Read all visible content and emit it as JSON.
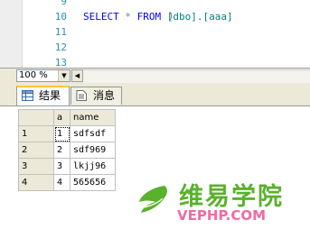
{
  "editor": {
    "lines": [
      {
        "num": "9",
        "code_paren": ")"
      },
      {
        "num": "10",
        "kw_select": "SELECT",
        "star": "*",
        "kw_from": "FROM",
        "table": "[dbo].[aaa]"
      },
      {
        "num": "11"
      },
      {
        "num": "12"
      },
      {
        "num": "13"
      }
    ]
  },
  "zoom": {
    "value": "100 %"
  },
  "tabs": [
    {
      "label": "结果",
      "icon": "grid-icon",
      "active": true
    },
    {
      "label": "消息",
      "icon": "message-icon",
      "active": false
    }
  ],
  "results": {
    "columns": [
      "a",
      "name"
    ],
    "rows": [
      {
        "row_num": "1",
        "a": "1",
        "name": "sdfsdf"
      },
      {
        "row_num": "2",
        "a": "2",
        "name": "sdf969"
      },
      {
        "row_num": "3",
        "a": "3",
        "name": "lkjj96"
      },
      {
        "row_num": "4",
        "a": "4",
        "name": "565656"
      }
    ]
  },
  "watermark": {
    "chinese": "维易学院",
    "domain": "VEPHP.COM",
    "colors": {
      "green": "#5ab12c",
      "pink": "#f26aa0"
    }
  }
}
